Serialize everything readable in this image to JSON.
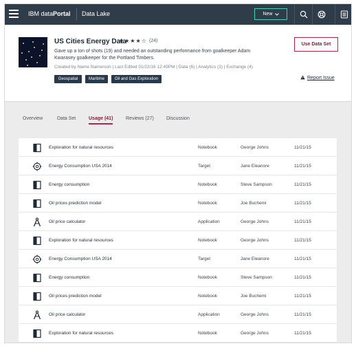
{
  "header": {
    "brand_regular": "IBM data",
    "brand_bold": "Portal",
    "breadcrumb": "Data Lake",
    "new_label": "New",
    "icons": [
      "search-icon",
      "help-icon",
      "user-icon"
    ]
  },
  "dataset": {
    "title": "US Cities Energy Data",
    "stars": "★★★★☆",
    "review_count": "(24)",
    "description": "Gave up a ton of shots (19) and needed an outstanding performance from goalkeeper Adam Kwarasey goalkeeper for the Portland Timbers.",
    "meta": "Created by Name Namerson   |   Last Edited 01/22/16 12:49PM   |   Data (6)   |   Analytics (3)   |   Exchange (4)",
    "tags": [
      "Geospatial",
      "Maritime",
      "Oil and Gas Exploration"
    ],
    "use_button": "Use Data Set",
    "report_issue": "Report Issue"
  },
  "tabs": [
    {
      "label": "Overview"
    },
    {
      "label": "Data Set"
    },
    {
      "label": "Usage (41)",
      "active": true
    },
    {
      "label": "Reviews (27)"
    },
    {
      "label": "Discussion"
    }
  ],
  "usage_rows": [
    {
      "icon": "notebook-icon",
      "name": "Exploration for natural resources",
      "type": "Notebook",
      "owner": "George Johns",
      "date": "11/21/15"
    },
    {
      "icon": "target-icon",
      "name": "Energy Consumption  USA 2014",
      "type": "Target",
      "owner": "Jane Eleanore",
      "date": "11/21/15"
    },
    {
      "icon": "notebook-icon",
      "name": "Energy consumption",
      "type": "Notebook",
      "owner": "Steve Sampson",
      "date": "11/21/15"
    },
    {
      "icon": "notebook-icon",
      "name": "Oil prices prediction model",
      "type": "Notebook",
      "owner": "Joe Buchemi",
      "date": "11/21/15"
    },
    {
      "icon": "compass-icon",
      "name": "Oil price calculator",
      "type": "Application",
      "owner": "George Johns",
      "date": "11/21/15"
    },
    {
      "icon": "notebook-icon",
      "name": "Exploration for natural resources",
      "type": "Notebook",
      "owner": "George Johns",
      "date": "11/21/15"
    },
    {
      "icon": "target-icon",
      "name": "Energy Consumption  USA 2014",
      "type": "Target",
      "owner": "Jane Eleanore",
      "date": "11/21/15"
    },
    {
      "icon": "notebook-icon",
      "name": "Energy consumption",
      "type": "Notebook",
      "owner": "Steve Sampson",
      "date": "11/21/15"
    },
    {
      "icon": "notebook-icon",
      "name": "Oil prices prediction model",
      "type": "Notebook",
      "owner": "Joe Buchemi",
      "date": "11/21/15"
    },
    {
      "icon": "compass-icon",
      "name": "Oil price calculator",
      "type": "Application",
      "owner": "George Johns",
      "date": "11/21/15"
    },
    {
      "icon": "notebook-icon",
      "name": "Exploration for natural resources",
      "type": "Notebook",
      "owner": "George Johns",
      "date": "11/21/15"
    }
  ],
  "colors": {
    "header_bg": "#2f3d4b",
    "accent": "#b8224d",
    "new_border": "#3fd0b3",
    "tag_bg": "#27394a"
  }
}
